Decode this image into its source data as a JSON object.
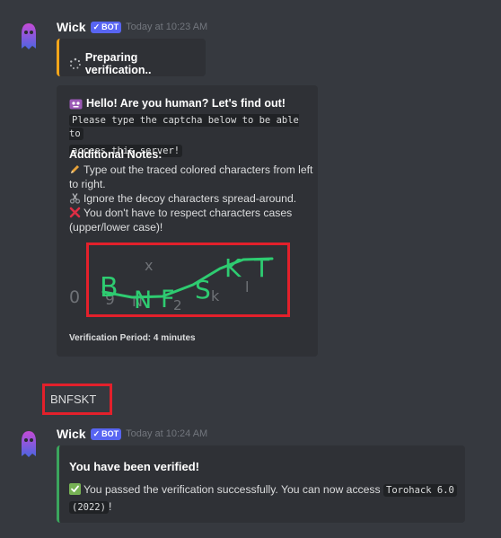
{
  "messages": [
    {
      "author": "Wick",
      "bot_tag": "BOT",
      "timestamp": "Today at 10:23 AM",
      "status_embed": {
        "text": "Preparing verification..",
        "icon": "loading-icon"
      },
      "captcha_embed": {
        "title": "Hello! Are you human? Let's find out!",
        "instruction_lines": [
          "Please type the captcha below to be able to",
          "access this server!"
        ],
        "notes_heading": "Additional Notes:",
        "notes": [
          {
            "icon": "pencil-icon",
            "lines": [
              "Type out the traced colored characters from left",
              "to right."
            ]
          },
          {
            "icon": "scissors-icon",
            "lines": [
              "Ignore the decoy characters spread-around."
            ]
          },
          {
            "icon": "cross-mark-icon",
            "lines": [
              "You don't have to respect characters cases",
              "(upper/lower case)!"
            ]
          }
        ],
        "captcha_text": [
          "B",
          "N",
          "F",
          "S",
          "K",
          "T"
        ],
        "decoy_characters": [
          "x",
          "0",
          "9",
          "N",
          "2",
          "k",
          "l"
        ],
        "footer": "Verification Period: 4 minutes"
      }
    },
    {
      "author_reply": "BNFSKT"
    },
    {
      "author": "Wick",
      "bot_tag": "BOT",
      "timestamp": "Today at 10:24 AM",
      "verified_embed": {
        "title": "You have been verified!",
        "text_before": "You passed the verification successfully. You can now access",
        "server_name": "Torohack 6.0 (2022)",
        "server_name_line1": "Torohack 6.0",
        "server_name_line2": "(2022)",
        "text_after": "!"
      }
    }
  ],
  "colors": {
    "background": "#36393f",
    "embed_bg": "#2f3136",
    "warning_bar": "#faa61a",
    "success_bar": "#3ba55d",
    "captcha_green": "#2ecc71",
    "highlight": "#e3202b",
    "bot_tag": "#5865f2"
  }
}
